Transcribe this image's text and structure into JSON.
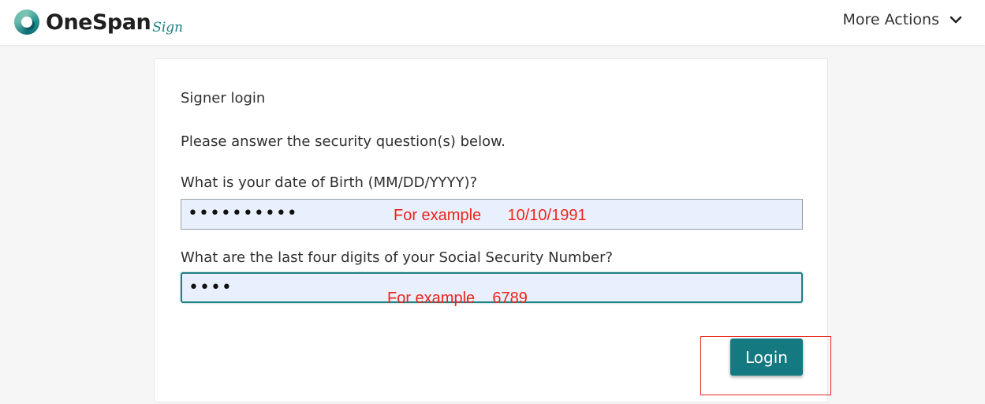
{
  "header": {
    "logo_text": "OneSpan",
    "logo_suffix": "Sign",
    "more_actions_label": "More Actions"
  },
  "card": {
    "title": "Signer login",
    "instructions": "Please answer the security question(s) below.",
    "questions": [
      {
        "label": "What is your date of Birth (MM/DD/YYYY)?",
        "value": "••••••••••",
        "example": "For example      10/10/1991"
      },
      {
        "label": "What are the last four digits of your Social Security Number?",
        "value": "••••",
        "example": "For example    6789"
      }
    ],
    "login_label": "Login"
  },
  "colors": {
    "brand": "#157982",
    "annotation": "#f2231c",
    "field_bg": "#e8f0fe"
  },
  "icons": {
    "logo": "onespan-logo-icon",
    "more_actions": "chevron-down-icon"
  }
}
